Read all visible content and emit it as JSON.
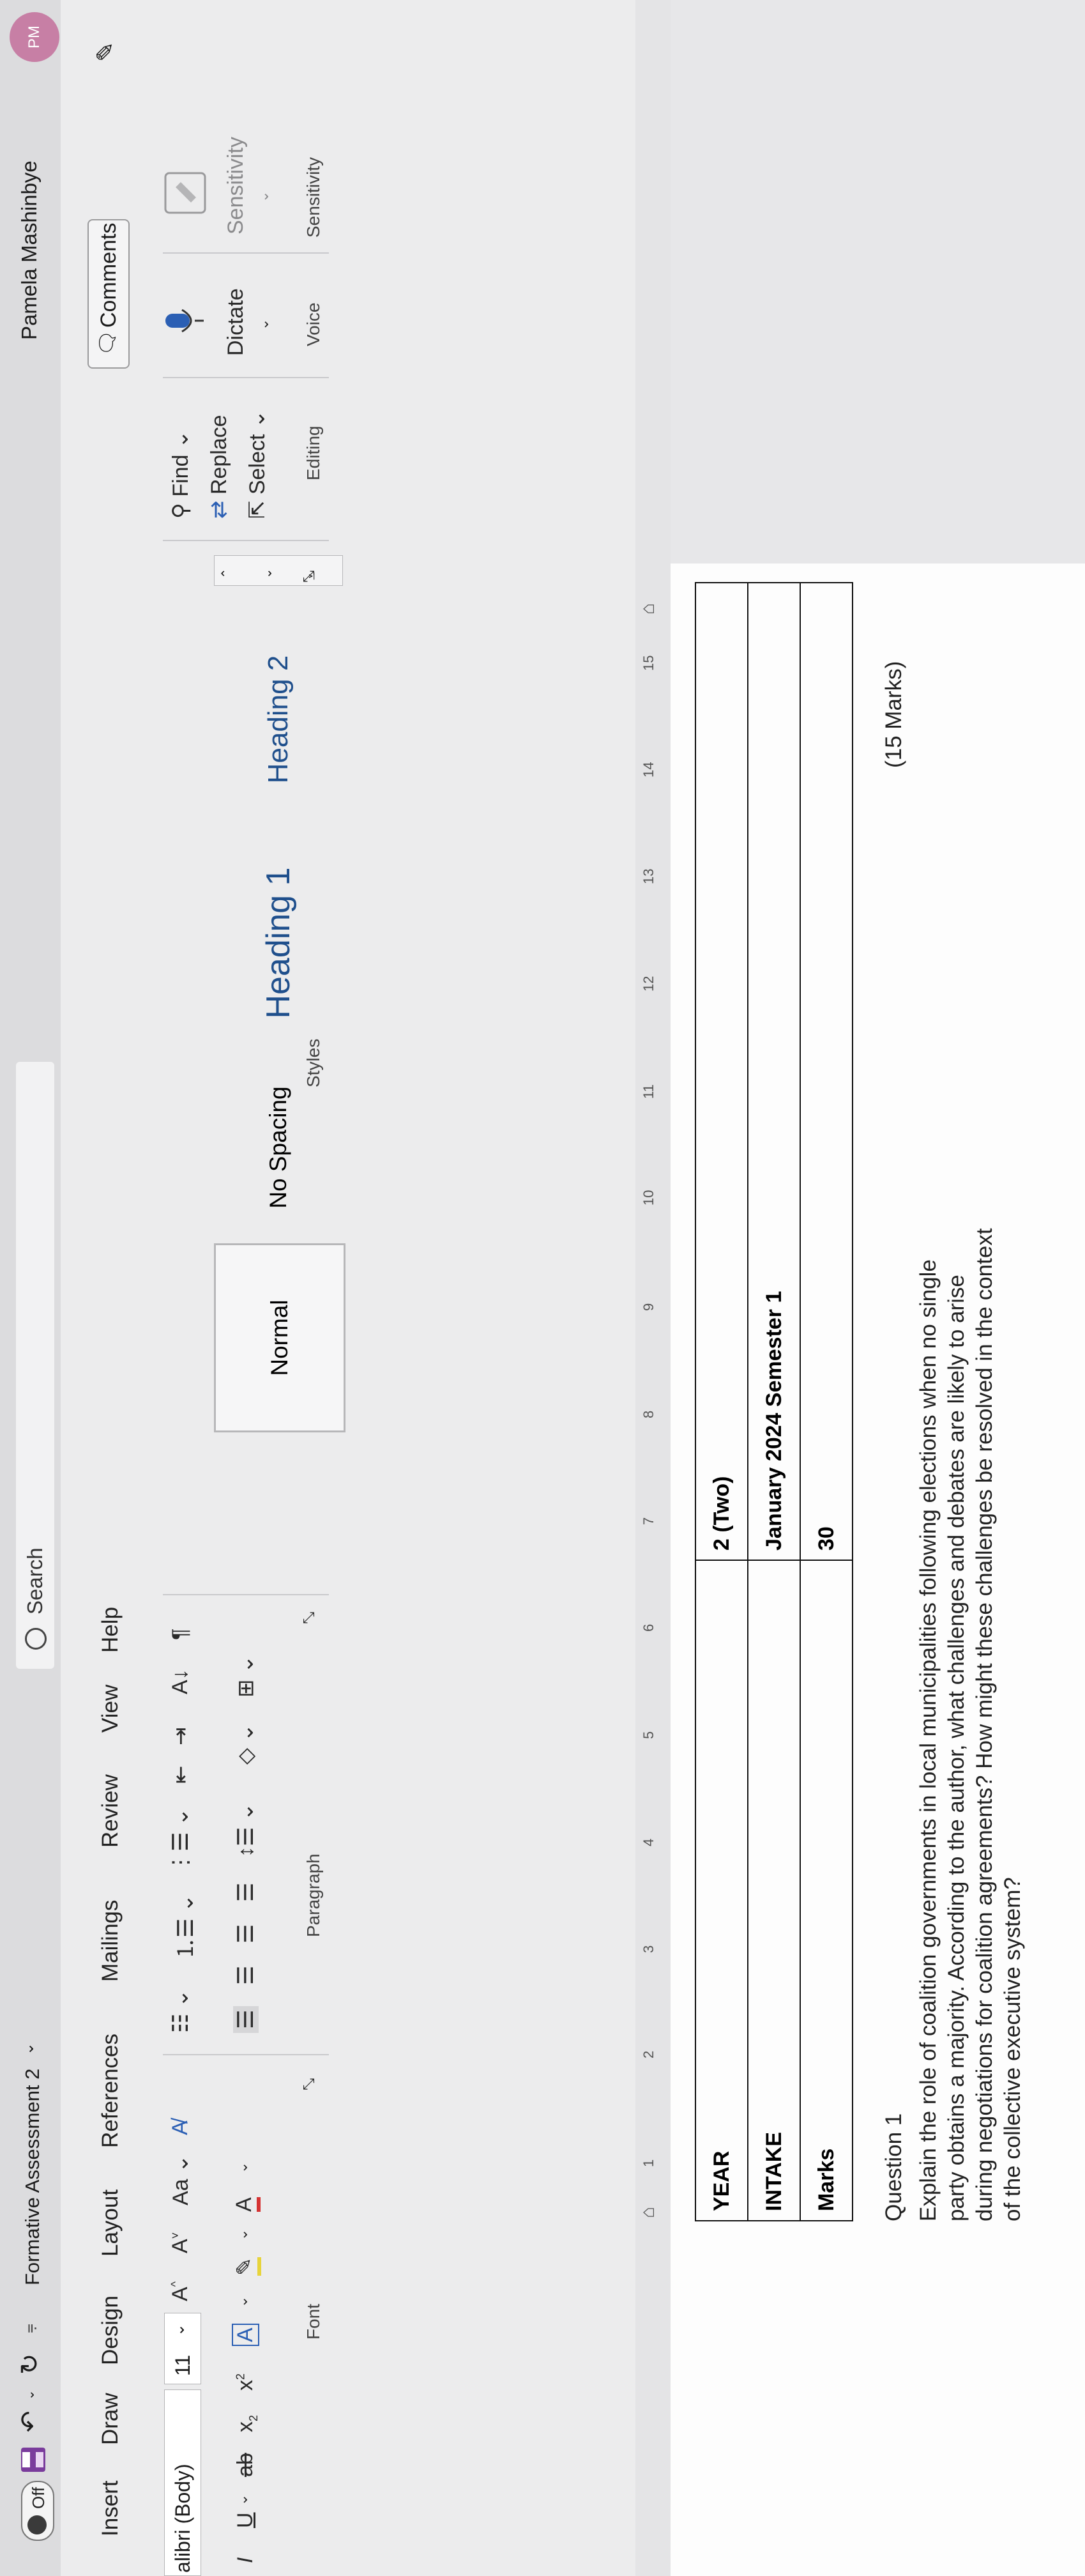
{
  "titlebar": {
    "autosave_label": "Off",
    "document_title": "Formative Assessment 2",
    "search_placeholder": "Search",
    "user_name": "Pamela Mashinbye",
    "user_initials": "PM"
  },
  "tabs": [
    "Insert",
    "Draw",
    "Design",
    "Layout",
    "References",
    "Mailings",
    "Review",
    "View",
    "Help"
  ],
  "font": {
    "name": "alibri (Body)",
    "size": "11",
    "case_label": "Aa",
    "group_label": "Font"
  },
  "paragraph": {
    "group_label": "Paragraph"
  },
  "styles": {
    "items": [
      "Normal",
      "No Spacing",
      "Heading 1",
      "Heading 2"
    ],
    "selected": "Normal",
    "group_label": "Styles"
  },
  "editing": {
    "find": "Find",
    "replace": "Replace",
    "select": "Select",
    "group_label": "Editing"
  },
  "voice": {
    "dictate": "Dictate",
    "group_label": "Voice"
  },
  "sensitivity": {
    "button": "Sensitivity",
    "group_label": "Sensitivity"
  },
  "comments_label": "Comments",
  "ruler_numbers": [
    "1",
    "2",
    "3",
    "4",
    "5",
    "6",
    "7",
    "8",
    "9",
    "10",
    "11",
    "12",
    "13",
    "14",
    "15"
  ],
  "document": {
    "table": [
      [
        "YEAR",
        "2 (Two)"
      ],
      [
        "INTAKE",
        "January 2024 Semester 1"
      ],
      [
        "Marks",
        "30"
      ]
    ],
    "question_title": "Question 1",
    "marks": "(15 Marks)",
    "question_lines": [
      "Explain the role of coalition governments in local municipalities following elections when no single",
      "party obtains a majority. According to the author, what challenges and debates are likely to arise",
      "during negotiations for coalition agreements? How might these challenges be resolved in the context",
      "of the collective executive system?"
    ]
  }
}
